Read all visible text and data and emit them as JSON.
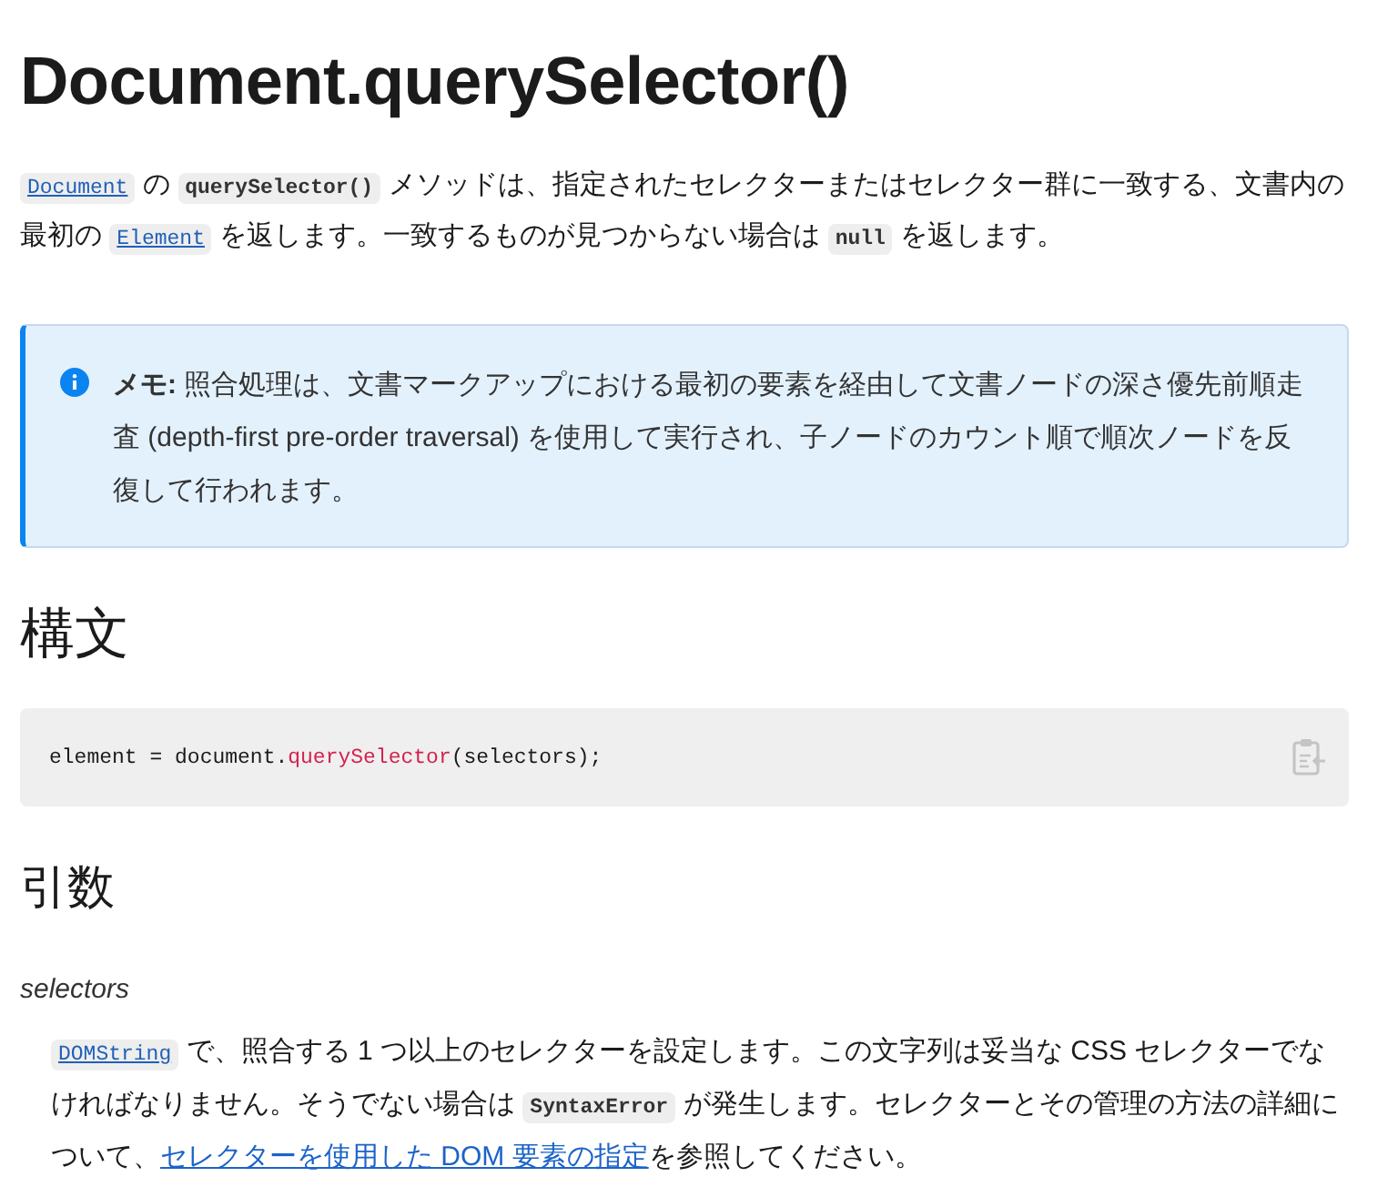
{
  "title": "Document.querySelector()",
  "intro": [
    {
      "kind": "code-link",
      "text": "Document"
    },
    {
      "kind": "text",
      "text": " の "
    },
    {
      "kind": "code",
      "text": "querySelector()"
    },
    {
      "kind": "text",
      "text": " メソッドは、指定されたセレクターまたはセレクター群に一致する、文書内の最初の "
    },
    {
      "kind": "code-link",
      "text": "Element"
    },
    {
      "kind": "text",
      "text": " を返します。一致するものが見つからない場合は "
    },
    {
      "kind": "code",
      "text": "null"
    },
    {
      "kind": "text",
      "text": " を返します。"
    }
  ],
  "note": {
    "text": "**メモ:** 照合処理は、文書マークアップにおける最初の要素を経由して文書ノードの深さ優先前順走査 (depth-first pre-order traversal) を使用して実行され、子ノードのカウント順で順次ノードを反復して行われます。"
  },
  "syntax": {
    "heading": "構文",
    "code": [
      {
        "kind": "plain",
        "text": "element = document."
      },
      {
        "kind": "method",
        "text": "querySelector"
      },
      {
        "kind": "plain",
        "text": "(selectors);"
      }
    ]
  },
  "params": {
    "heading": "引数",
    "items": [
      {
        "name": "selectors",
        "description": [
          {
            "kind": "code-link",
            "text": "DOMString"
          },
          {
            "kind": "text",
            "text": " で、照合する 1 つ以上のセレクターを設定します。この文字列は妥当な CSS セレクターでなければなりません。そうでない場合は "
          },
          {
            "kind": "code",
            "text": "SyntaxError"
          },
          {
            "kind": "text",
            "text": " が発生します。セレクターとその管理の方法の詳細について、"
          },
          {
            "kind": "link",
            "text": "セレクターを使用した DOM 要素の指定"
          },
          {
            "kind": "text",
            "text": "を参照してください。"
          }
        ]
      }
    ]
  }
}
